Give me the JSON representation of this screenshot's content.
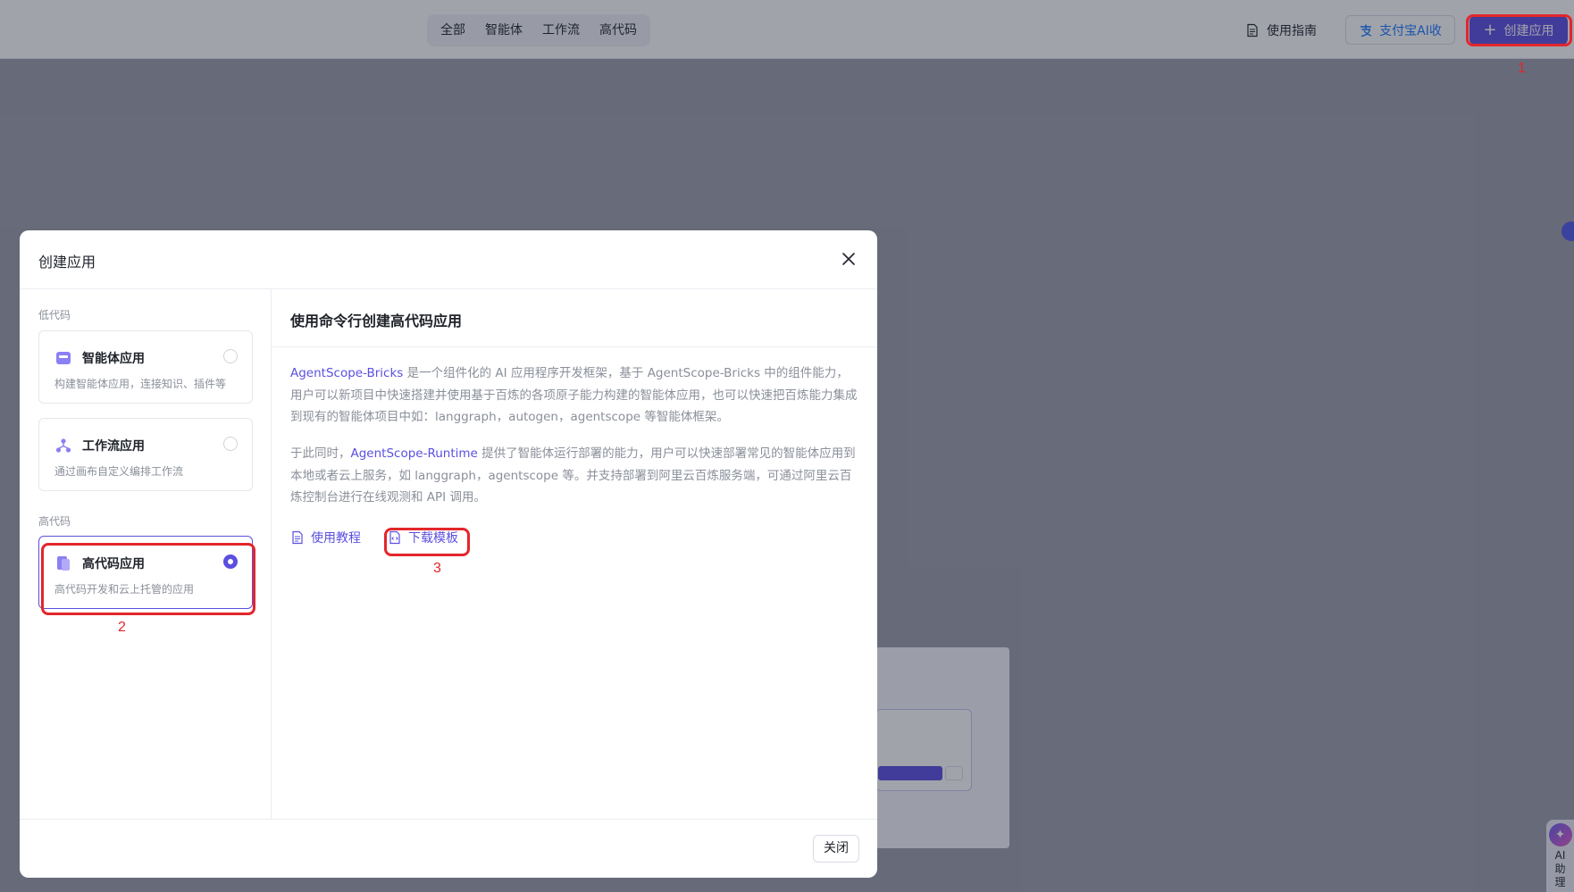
{
  "topbar": {
    "segments": [
      "全部",
      "智能体",
      "工作流",
      "高代码"
    ],
    "guide_label": "使用指南",
    "alipay_label": "支付宝AI收",
    "create_label": "创建应用"
  },
  "annotations": [
    "1",
    "2",
    "3"
  ],
  "ai_helper": {
    "label": "AI助理"
  },
  "modal": {
    "title": "创建应用",
    "groups": {
      "low_code": "低代码",
      "high_code": "高代码"
    },
    "types": [
      {
        "name": "智能体应用",
        "desc": "构建智能体应用，连接知识、插件等",
        "selected": false
      },
      {
        "name": "工作流应用",
        "desc": "通过画布自定义编排工作流",
        "selected": false
      },
      {
        "name": "高代码应用",
        "desc": "高代码开发和云上托管的应用",
        "selected": true
      }
    ],
    "right": {
      "title": "使用命令行创建高代码应用",
      "p1_link": "AgentScope-Bricks",
      "p1_text": " 是一个组件化的 AI 应用程序开发框架，基于 AgentScope-Bricks 中的组件能力，用户可以新项目中快速搭建并使用基于百炼的各项原子能力构建的智能体应用，也可以快速把百炼能力集成到现有的智能体项目中如：langgraph，autogen，agentscope 等智能体框架。",
      "p2_prefix": "于此同时，",
      "p2_link": "AgentScope-Runtime",
      "p2_text": " 提供了智能体运行部署的能力，用户可以快速部署常见的智能体应用到本地或者云上服务，如 langgraph，agentscope 等。并支持部署到阿里云百炼服务端，可通过阿里云百炼控制台进行在线观测和 API 调用。",
      "tutorial_label": "使用教程",
      "download_label": "下载模板"
    },
    "close_label": "关闭"
  },
  "colors": {
    "accent": "#5b4fe0",
    "annotation": "#e3262b",
    "alipay": "#1677ff"
  }
}
